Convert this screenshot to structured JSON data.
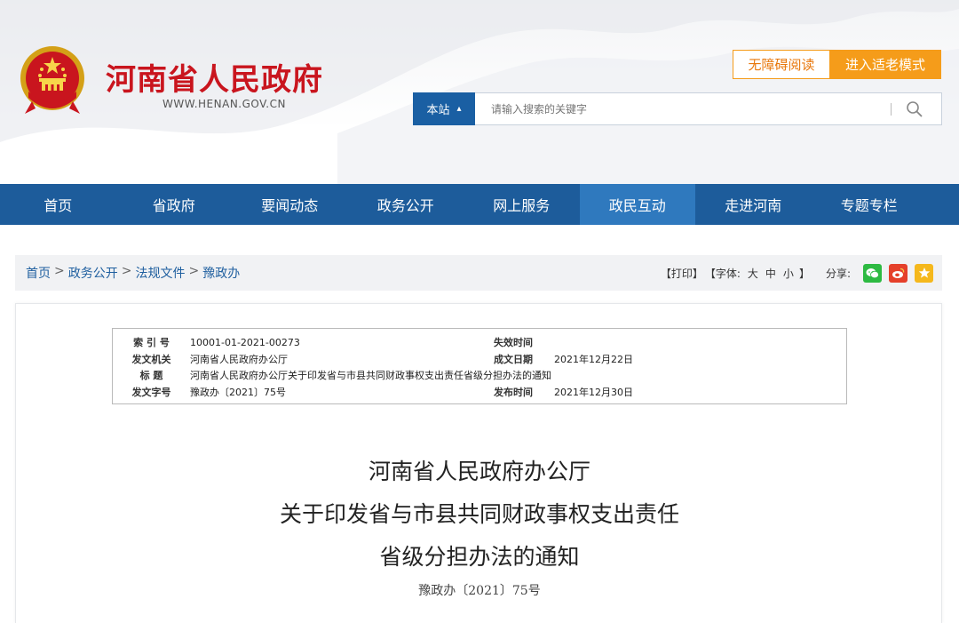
{
  "header": {
    "site_title": "河南省人民政府",
    "site_url": "WWW.HENAN.GOV.CN",
    "accessibility_label": "无障碍阅读",
    "elder_mode_label": "进入适老模式"
  },
  "search": {
    "scope": "本站",
    "placeholder": "请输入搜索的关键字"
  },
  "nav": {
    "items": [
      "首页",
      "省政府",
      "要闻动态",
      "政务公开",
      "网上服务",
      "政民互动",
      "走进河南",
      "专题专栏"
    ],
    "active": "政民互动"
  },
  "breadcrumb": {
    "items": [
      "首页",
      "政务公开",
      "法规文件",
      "豫政办"
    ],
    "separator": ">"
  },
  "tools": {
    "print": "【打印】",
    "font_label": "【字体:",
    "font_large": "大",
    "font_medium": "中",
    "font_small": "小",
    "font_close": "】",
    "share_label": "分享:",
    "share_icons": [
      "wechat-icon",
      "weibo-icon",
      "qzone-icon"
    ]
  },
  "meta": {
    "index_label": "索 引 号",
    "index_value": "10001-01-2021-00273",
    "expiry_label": "失效时间",
    "expiry_value": "",
    "issuer_label": "发文机关",
    "issuer_value": "河南省人民政府办公厅",
    "written_label": "成文日期",
    "written_value": "2021年12月22日",
    "title_label": "标 题",
    "title_value": "河南省人民政府办公厅关于印发省与市县共同财政事权支出责任省级分担办法的通知",
    "docno_label": "发文字号",
    "docno_value": "豫政办〔2021〕75号",
    "publish_label": "发布时间",
    "publish_value": "2021年12月30日"
  },
  "document": {
    "title_line1": "河南省人民政府办公厅",
    "title_line2": "关于印发省与市县共同财政事权支出责任",
    "title_line3": "省级分担办法的通知",
    "doc_number": "豫政办〔2021〕75号"
  },
  "colors": {
    "brand_red": "#c9151e",
    "nav_blue": "#1d5c9b",
    "nav_active": "#2f79be",
    "orange": "#f59c1a",
    "link_blue": "#1f5f9f"
  }
}
